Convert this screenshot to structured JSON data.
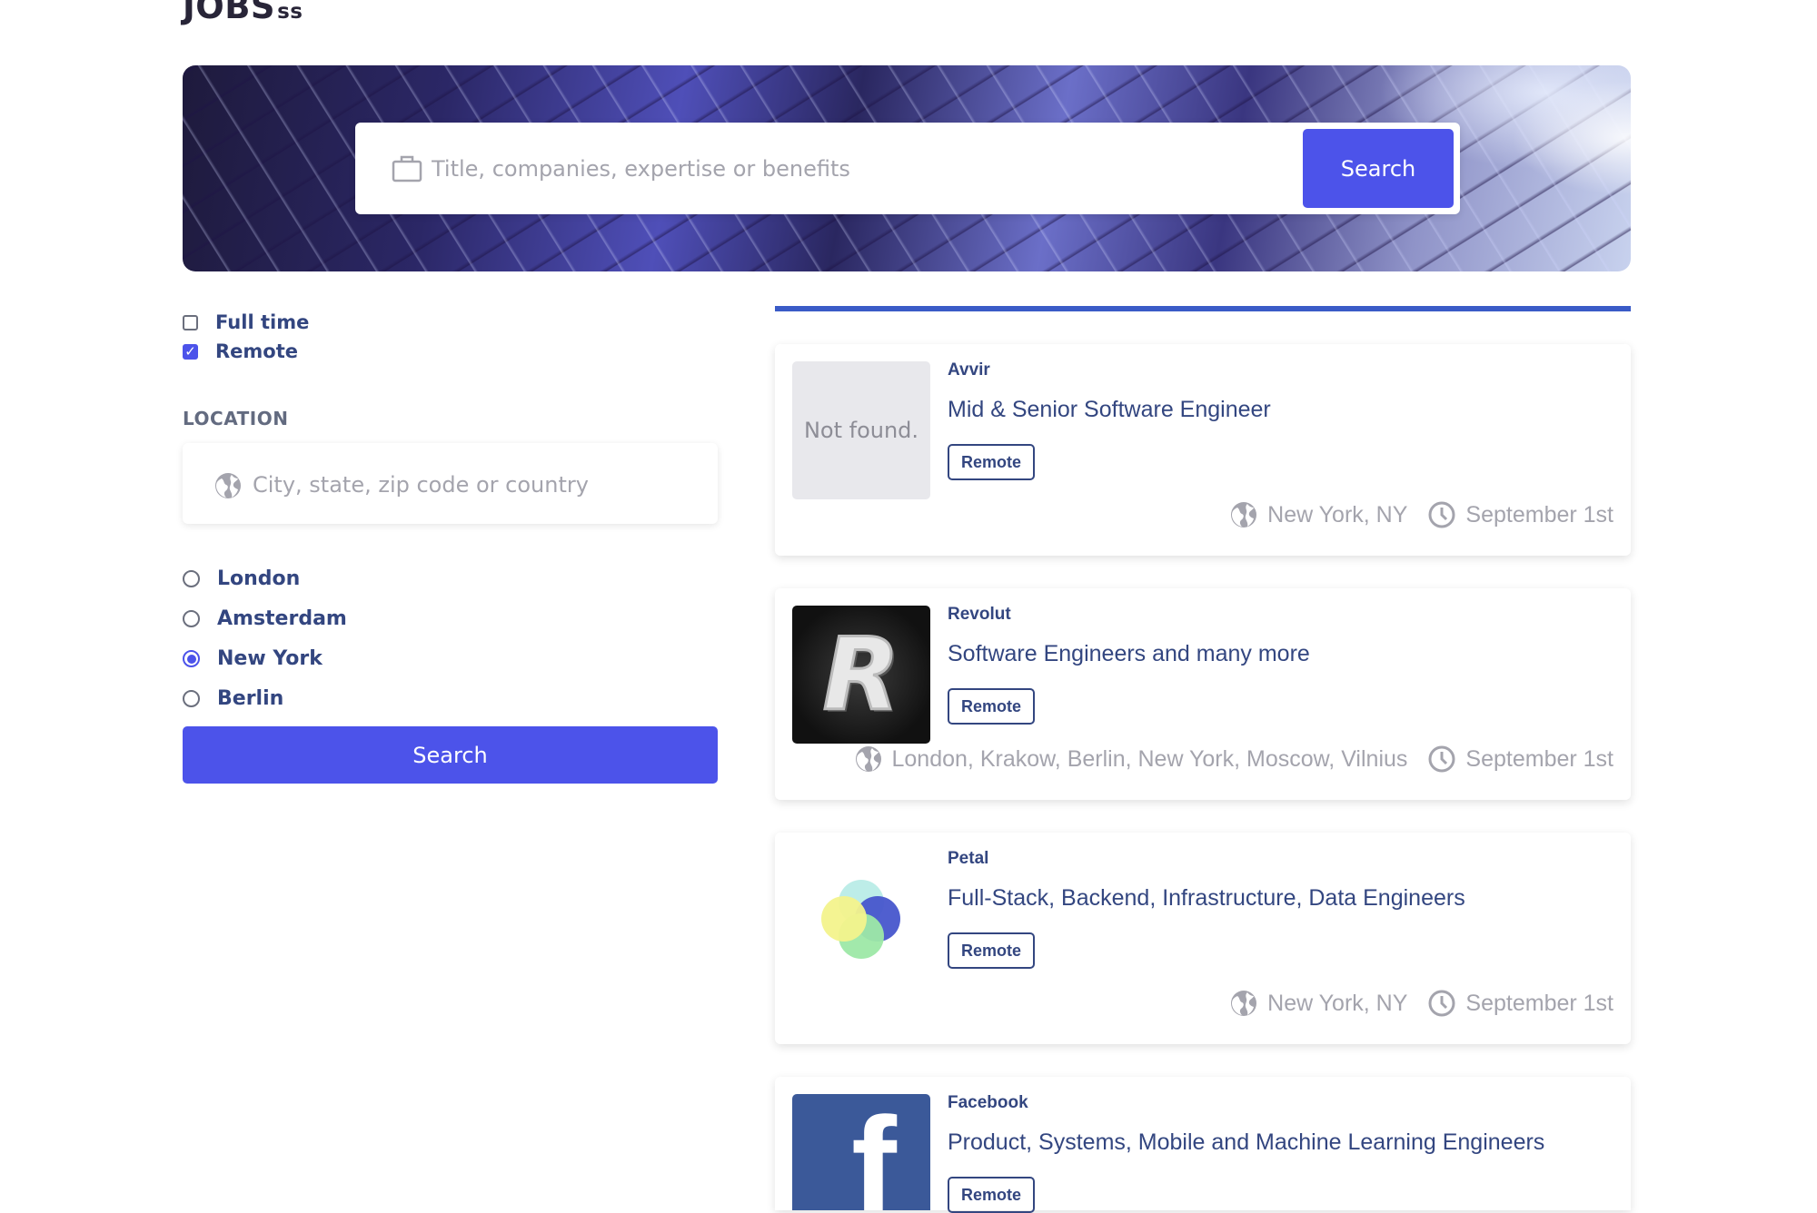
{
  "logo": {
    "main": "JOBS",
    "suffix": "ss"
  },
  "hero": {
    "search_placeholder": "Title, companies, expertise or benefits",
    "search_button": "Search",
    "icon": "briefcase-icon"
  },
  "filters": {
    "checkboxes": [
      {
        "label": "Full time",
        "checked": false
      },
      {
        "label": "Remote",
        "checked": true
      }
    ],
    "location_title": "LOCATION",
    "location_placeholder": "City, state, zip code or country",
    "locations": [
      {
        "label": "London",
        "selected": false
      },
      {
        "label": "Amsterdam",
        "selected": false
      },
      {
        "label": "New York",
        "selected": true
      },
      {
        "label": "Berlin",
        "selected": false
      }
    ],
    "search_button": "Search"
  },
  "loading_progress": 1.0,
  "jobs": [
    {
      "company": "Avvir",
      "title": "Mid & Senior Software Engineer",
      "tag": "Remote",
      "location": "New York, NY",
      "date": "September 1st",
      "logo": "Not found."
    },
    {
      "company": "Revolut",
      "title": "Software Engineers and many more",
      "tag": "Remote",
      "location": "London, Krakow, Berlin, New York, Moscow, Vilnius",
      "date": "September 1st",
      "logo": "R"
    },
    {
      "company": "Petal",
      "title": "Full-Stack, Backend, Infrastructure, Data Engineers",
      "tag": "Remote",
      "location": "New York, NY",
      "date": "September 1st",
      "logo": "petal-logo"
    },
    {
      "company": "Facebook",
      "title": "Product, Systems, Mobile and Machine Learning Engineers",
      "tag": "Remote",
      "location": "",
      "date": "",
      "logo": "f"
    }
  ],
  "colors": {
    "accent": "#4c53ea",
    "text": "#334680",
    "muted": "#a4a4ad",
    "progress": "#3a5bc7"
  }
}
